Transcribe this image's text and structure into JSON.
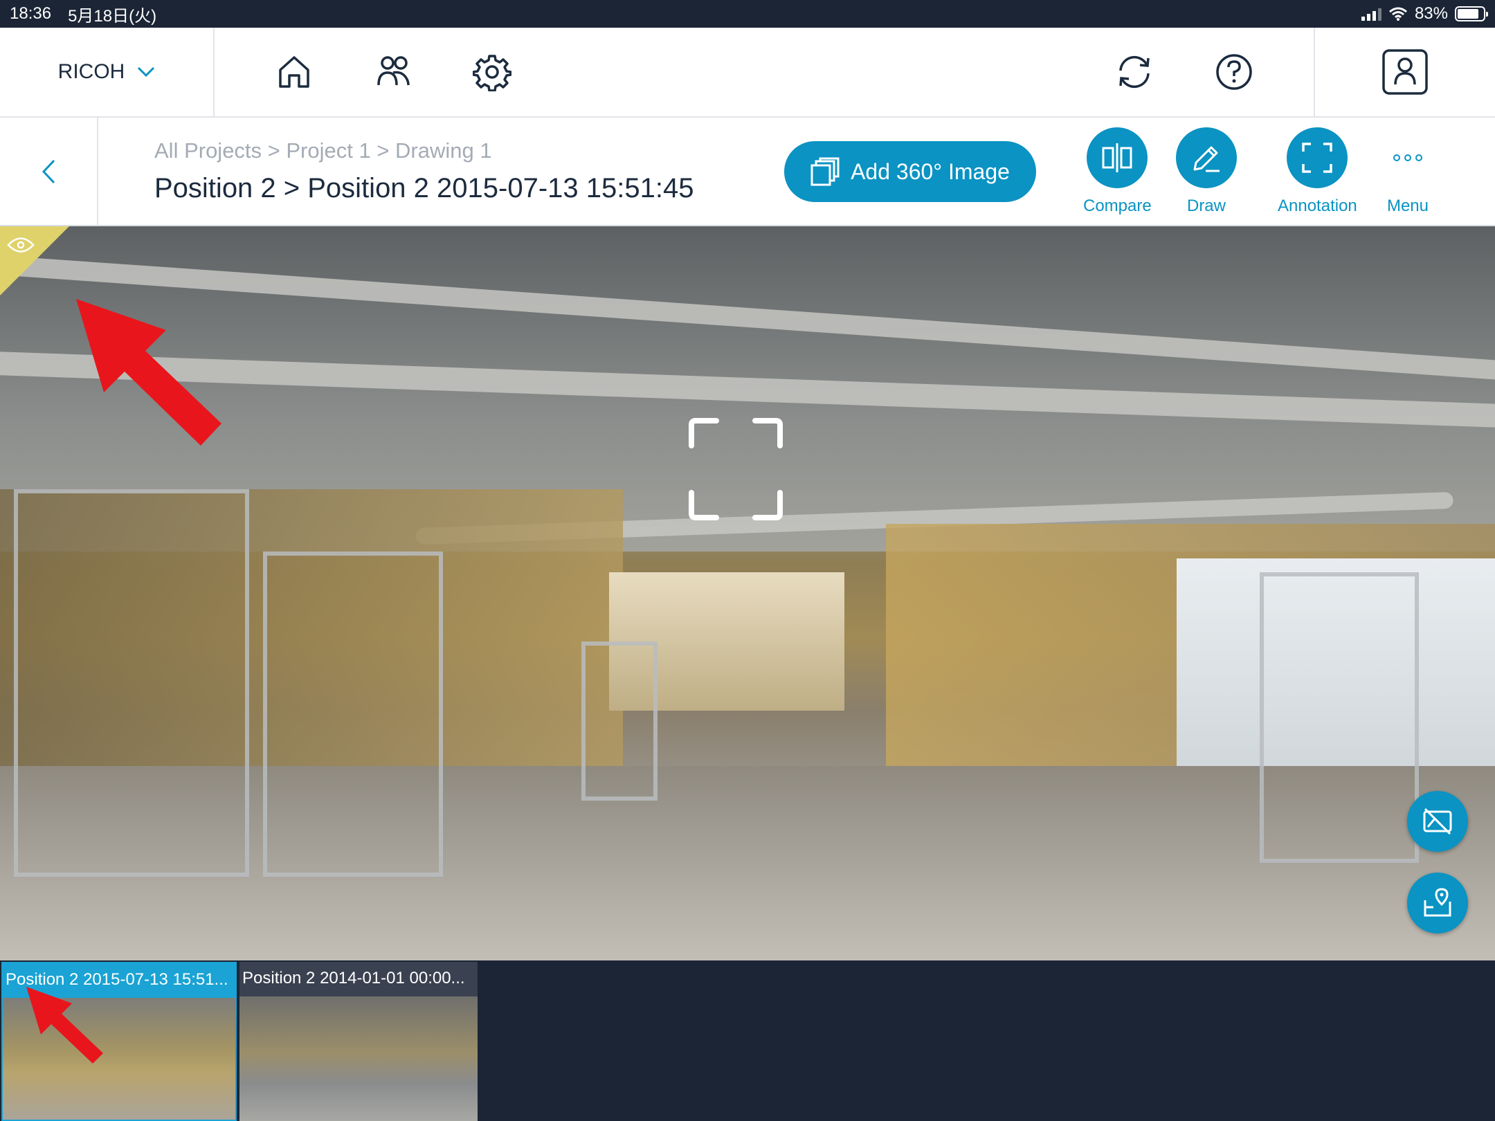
{
  "status": {
    "time": "18:36",
    "date": "5月18日(火)",
    "battery": "83%",
    "battery_level": 0.83
  },
  "nav": {
    "brand": "RICOH",
    "icons": [
      "home-icon",
      "users-icon",
      "settings-icon",
      "sync-icon",
      "help-icon",
      "profile-icon"
    ]
  },
  "header": {
    "breadcrumb": "All Projects > Project 1 > Drawing 1",
    "title": "Position 2 > Position 2 2015-07-13 15:51:45",
    "add_button": "Add 360° Image",
    "tools": {
      "compare": "Compare",
      "draw": "Draw",
      "annotation": "Annotation",
      "menu": "Menu"
    }
  },
  "thumbnails": [
    {
      "caption": "Position 2 2015-07-13 15:51...",
      "selected": true
    },
    {
      "caption": "Position 2 2014-01-01 00:00...",
      "selected": false
    }
  ],
  "colors": {
    "accent": "#0a93c3",
    "dark": "#1b2535",
    "marker": "#dfd26a",
    "annotation_arrow": "#e8161c"
  }
}
